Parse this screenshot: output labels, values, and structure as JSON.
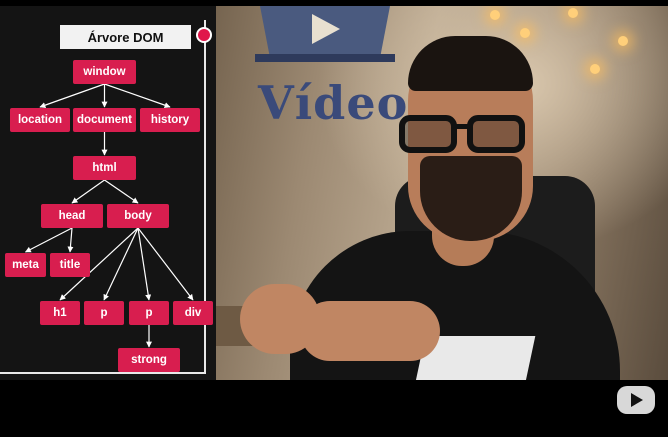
{
  "diagram": {
    "title": "Árvore DOM",
    "nodes": {
      "window": "window",
      "location": "location",
      "document": "document",
      "history": "history",
      "html": "html",
      "head": "head",
      "body": "body",
      "meta": "meta",
      "title": "title",
      "h1": "h1",
      "p1": "p",
      "p2": "p",
      "div": "div",
      "strong": "strong"
    },
    "edges": [
      [
        "window",
        "location"
      ],
      [
        "window",
        "document"
      ],
      [
        "window",
        "history"
      ],
      [
        "document",
        "html"
      ],
      [
        "html",
        "head"
      ],
      [
        "html",
        "body"
      ],
      [
        "head",
        "meta"
      ],
      [
        "head",
        "title"
      ],
      [
        "body",
        "h1"
      ],
      [
        "body",
        "p1"
      ],
      [
        "body",
        "p2"
      ],
      [
        "body",
        "div"
      ],
      [
        "p2",
        "strong"
      ]
    ]
  },
  "background": {
    "logo_text": "Vídeo"
  },
  "colors": {
    "node": "#d81e4f",
    "accent_dot": "#e0174a",
    "panel": "#141414"
  }
}
